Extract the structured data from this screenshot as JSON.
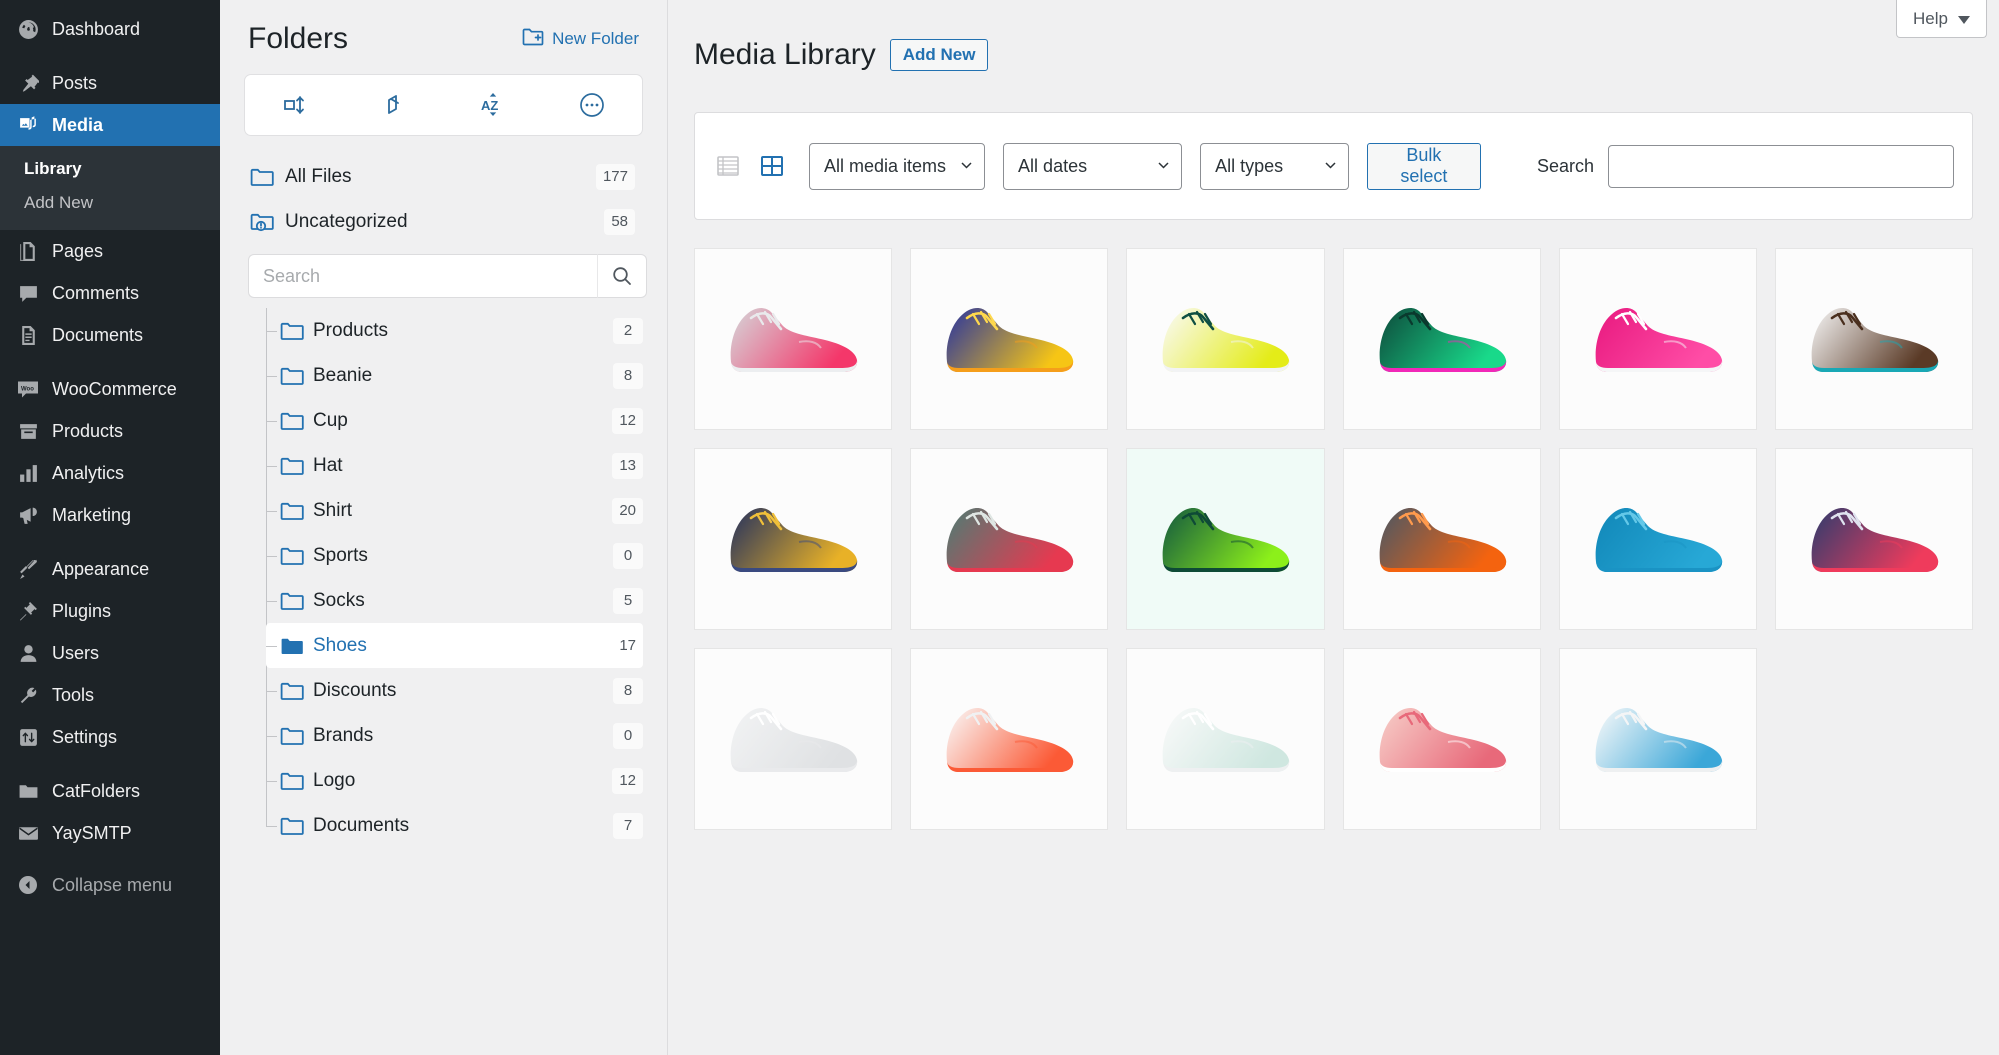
{
  "sidebar": {
    "items": [
      {
        "label": "Dashboard",
        "icon": "dashboard-icon",
        "gap_after": true
      },
      {
        "label": "Posts",
        "icon": "pin-icon"
      },
      {
        "label": "Media",
        "icon": "media-icon",
        "current": true
      },
      {
        "label": "Pages",
        "icon": "pages-icon"
      },
      {
        "label": "Comments",
        "icon": "comments-icon"
      },
      {
        "label": "Documents",
        "icon": "documents-icon",
        "gap_after": true
      },
      {
        "label": "WooCommerce",
        "icon": "woo-icon"
      },
      {
        "label": "Products",
        "icon": "products-icon"
      },
      {
        "label": "Analytics",
        "icon": "analytics-icon"
      },
      {
        "label": "Marketing",
        "icon": "marketing-icon",
        "gap_after": true
      },
      {
        "label": "Appearance",
        "icon": "brush-icon"
      },
      {
        "label": "Plugins",
        "icon": "plugin-icon"
      },
      {
        "label": "Users",
        "icon": "users-icon"
      },
      {
        "label": "Tools",
        "icon": "wrench-icon"
      },
      {
        "label": "Settings",
        "icon": "settings-icon",
        "gap_after": true
      },
      {
        "label": "CatFolders",
        "icon": "folder-icon"
      },
      {
        "label": "YaySMTP",
        "icon": "envelope-icon"
      }
    ],
    "submenu": [
      {
        "label": "Library",
        "current": true
      },
      {
        "label": "Add New",
        "current": false
      }
    ],
    "collapse_label": "Collapse menu",
    "accent": "#2271b1",
    "background": "#1d2327"
  },
  "folders_panel": {
    "title": "Folders",
    "new_folder_label": "New Folder",
    "toolbar": [
      {
        "name": "toggle-panel-icon"
      },
      {
        "name": "expand-collapse-icon"
      },
      {
        "name": "sort-az-icon"
      },
      {
        "name": "more-options-icon"
      }
    ],
    "roots": [
      {
        "label": "All Files",
        "count": "177",
        "icon": "folder-icon"
      },
      {
        "label": "Uncategorized",
        "count": "58",
        "icon": "folder-alert-icon"
      }
    ],
    "search_placeholder": "Search",
    "search_value": "",
    "tree": [
      {
        "label": "Products",
        "count": "2",
        "selected": false
      },
      {
        "label": "Beanie",
        "count": "8",
        "selected": false
      },
      {
        "label": "Cup",
        "count": "12",
        "selected": false
      },
      {
        "label": "Hat",
        "count": "13",
        "selected": false
      },
      {
        "label": "Shirt",
        "count": "20",
        "selected": false
      },
      {
        "label": "Sports",
        "count": "0",
        "selected": false
      },
      {
        "label": "Socks",
        "count": "5",
        "selected": false
      },
      {
        "label": "Shoes",
        "count": "17",
        "selected": true
      },
      {
        "label": "Discounts",
        "count": "8",
        "selected": false
      },
      {
        "label": "Brands",
        "count": "0",
        "selected": false
      },
      {
        "label": "Logo",
        "count": "12",
        "selected": false
      },
      {
        "label": "Documents",
        "count": "7",
        "selected": false
      }
    ]
  },
  "main": {
    "help_label": "Help",
    "page_title": "Media Library",
    "add_new_label": "Add New",
    "toolbar": {
      "list_view_icon": "list-view-icon",
      "grid_view_icon": "grid-view-icon",
      "media_filter": "All media items",
      "date_filter": "All dates",
      "type_filter": "All types",
      "bulk_select_label": "Bulk select",
      "search_label": "Search",
      "search_value": "",
      "search_placeholder": ""
    },
    "grid_items": [
      {
        "name": "shoe-grey-pink",
        "body": "#d5d7da",
        "accent": "#f4376a",
        "sole": "#eceef0",
        "lace": "#e9eaec",
        "highlight": false
      },
      {
        "name": "shoe-blue-yellow",
        "body": "#2733a0",
        "accent": "#f6c515",
        "sole": "#f59e1b",
        "lace": "#ffd84d",
        "highlight": false
      },
      {
        "name": "shoe-white-yellow",
        "body": "#fafafa",
        "accent": "#e4ec18",
        "sole": "#f2f3f4",
        "lace": "#0f4f42",
        "highlight": false
      },
      {
        "name": "shoe-green-magenta",
        "body": "#0d4a3b",
        "accent": "#19d98a",
        "sole": "#f128b8",
        "lace": "#0a3a2e",
        "highlight": false
      },
      {
        "name": "shoe-pink",
        "body": "#e8197f",
        "accent": "#ff4da6",
        "sole": "#f5f6f7",
        "lace": "#ffffff",
        "highlight": false
      },
      {
        "name": "shoe-white-brown",
        "body": "#f7f7f7",
        "accent": "#5a3a26",
        "sole": "#19a8b5",
        "lace": "#4a2f1e",
        "highlight": false
      },
      {
        "name": "shoe-navy-gold",
        "body": "#23305e",
        "accent": "#e8b127",
        "sole": "#3a4a80",
        "lace": "#f0c03a",
        "highlight": false
      },
      {
        "name": "shoe-teal-red",
        "body": "#4c7d74",
        "accent": "#e63950",
        "sole": "#e63950",
        "lace": "#dfe6e3",
        "highlight": false
      },
      {
        "name": "shoe-neon-green",
        "body": "#12583f",
        "accent": "#8cf01a",
        "sole": "#0e4a36",
        "lace": "#0e4a36",
        "highlight": true
      },
      {
        "name": "shoe-grey-orange",
        "body": "#4a5764",
        "accent": "#f4630f",
        "sole": "#f4630f",
        "lace": "#ff9a4d",
        "highlight": false
      },
      {
        "name": "shoe-cyan",
        "body": "#1187b8",
        "accent": "#27a8d6",
        "sole": "#1a93c4",
        "lace": "#64c8e8",
        "highlight": false
      },
      {
        "name": "shoe-navy-red",
        "body": "#2d3c6e",
        "accent": "#ef3b5c",
        "sole": "#ef3b5c",
        "lace": "#dfe3ef",
        "highlight": false
      },
      {
        "name": "shoe-white-grey",
        "body": "#f2f3f4",
        "accent": "#dfe1e3",
        "sole": "#e9eaec",
        "lace": "#ffffff",
        "highlight": false
      },
      {
        "name": "shoe-white-orange",
        "body": "#fafafa",
        "accent": "#fb5a36",
        "sole": "#fb5a36",
        "lace": "#f0f1f2",
        "highlight": false
      },
      {
        "name": "shoe-white-mint",
        "body": "#fafafa",
        "accent": "#cfe7e0",
        "sole": "#eef0f1",
        "lace": "#ffffff",
        "highlight": false
      },
      {
        "name": "shoe-pink-light",
        "body": "#f7cfc9",
        "accent": "#e8697a",
        "sole": "#ffffff",
        "lace": "#e8697a",
        "highlight": false
      },
      {
        "name": "shoe-white-blue",
        "body": "#fafafa",
        "accent": "#3ba7d8",
        "sole": "#eef0f1",
        "lace": "#f4f5f6",
        "highlight": false
      }
    ]
  }
}
